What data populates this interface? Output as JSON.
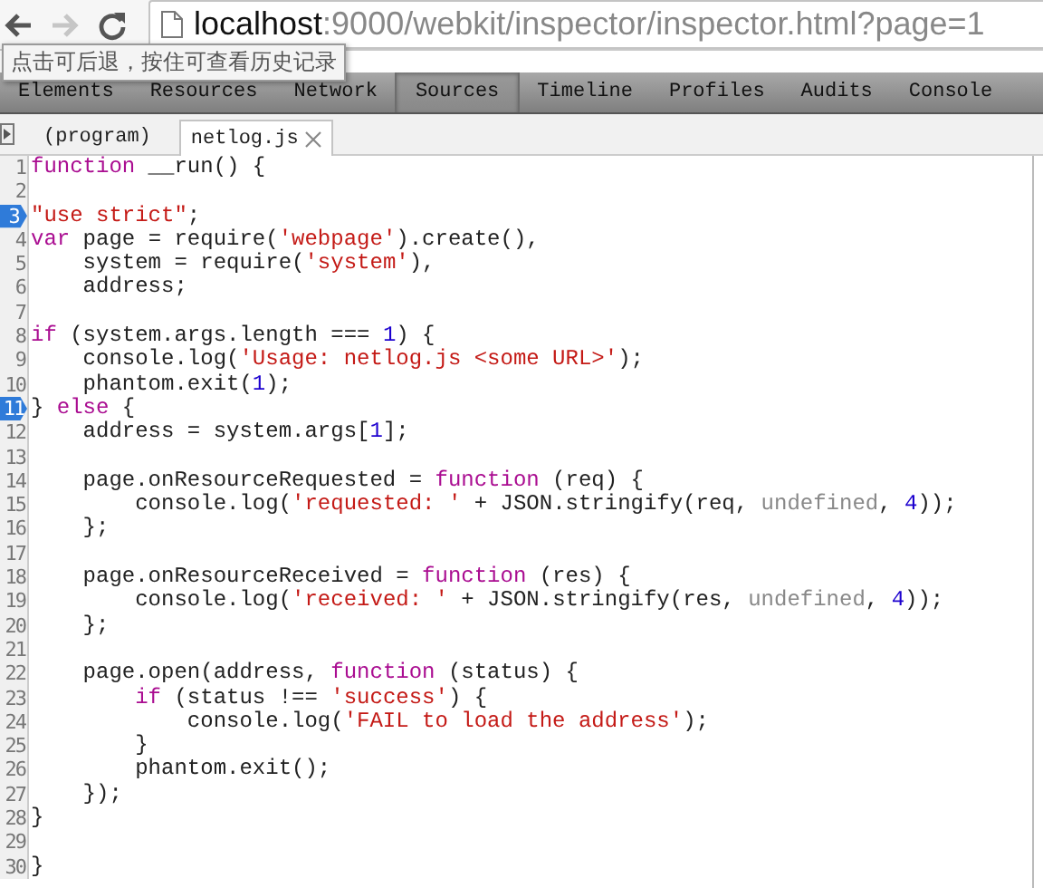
{
  "toolbar": {
    "back": {
      "disabled": false
    },
    "forward": {
      "disabled": true
    },
    "url": {
      "host": "localhost",
      "rest": ":9000/webkit/inspector/inspector.html?page=1"
    }
  },
  "tooltip": {
    "text": "点击可后退，按住可查看历史记录"
  },
  "tabs": [
    {
      "label": "Elements",
      "selected": false
    },
    {
      "label": "Resources",
      "selected": false
    },
    {
      "label": "Network",
      "selected": false
    },
    {
      "label": "Sources",
      "selected": true
    },
    {
      "label": "Timeline",
      "selected": false
    },
    {
      "label": "Profiles",
      "selected": false
    },
    {
      "label": "Audits",
      "selected": false
    },
    {
      "label": "Console",
      "selected": false
    }
  ],
  "file_tabs": [
    {
      "label": "(program)",
      "selected": false,
      "closable": false
    },
    {
      "label": "netlog.js",
      "selected": true,
      "closable": true
    }
  ],
  "code": {
    "lines": [
      {
        "number": "1",
        "breakpoint": false,
        "tokens": [
          {
            "kind": "keyword",
            "text": "function"
          },
          {
            "kind": "plain",
            "text": " __run() {"
          }
        ]
      },
      {
        "number": "2",
        "breakpoint": false
      },
      {
        "number": "3",
        "breakpoint": true,
        "tokens": [
          {
            "kind": "string",
            "text": "\"use strict\""
          },
          {
            "kind": "plain",
            "text": ";"
          }
        ]
      },
      {
        "number": "4",
        "breakpoint": false,
        "tokens": [
          {
            "kind": "keyword",
            "text": "var"
          },
          {
            "kind": "plain",
            "text": " page = require("
          },
          {
            "kind": "string",
            "text": "'webpage'"
          },
          {
            "kind": "plain",
            "text": ").create(),"
          }
        ]
      },
      {
        "number": "5",
        "breakpoint": false,
        "tokens": [
          {
            "kind": "plain",
            "text": "    system = require("
          },
          {
            "kind": "string",
            "text": "'system'"
          },
          {
            "kind": "plain",
            "text": "),"
          }
        ]
      },
      {
        "number": "6",
        "breakpoint": false,
        "tokens": [
          {
            "kind": "plain",
            "text": "    address;"
          }
        ]
      },
      {
        "number": "7",
        "breakpoint": false
      },
      {
        "number": "8",
        "breakpoint": false,
        "tokens": [
          {
            "kind": "keyword",
            "text": "if"
          },
          {
            "kind": "plain",
            "text": " (system.args.length === "
          },
          {
            "kind": "number",
            "text": "1"
          },
          {
            "kind": "plain",
            "text": ") {"
          }
        ]
      },
      {
        "number": "9",
        "breakpoint": false,
        "tokens": [
          {
            "kind": "plain",
            "text": "    console.log("
          },
          {
            "kind": "string",
            "text": "'Usage: netlog.js <some URL>'"
          },
          {
            "kind": "plain",
            "text": ");"
          }
        ]
      },
      {
        "number": "10",
        "breakpoint": false,
        "tokens": [
          {
            "kind": "plain",
            "text": "    phantom.exit("
          },
          {
            "kind": "number",
            "text": "1"
          },
          {
            "kind": "plain",
            "text": ");"
          }
        ]
      },
      {
        "number": "11",
        "breakpoint": true,
        "tokens": [
          {
            "kind": "plain",
            "text": "} "
          },
          {
            "kind": "keyword",
            "text": "else"
          },
          {
            "kind": "plain",
            "text": " {"
          }
        ]
      },
      {
        "number": "12",
        "breakpoint": false,
        "tokens": [
          {
            "kind": "plain",
            "text": "    address = system.args["
          },
          {
            "kind": "number",
            "text": "1"
          },
          {
            "kind": "plain",
            "text": "];"
          }
        ]
      },
      {
        "number": "13",
        "breakpoint": false
      },
      {
        "number": "14",
        "breakpoint": false,
        "tokens": [
          {
            "kind": "plain",
            "text": "    page.onResourceRequested = "
          },
          {
            "kind": "keyword",
            "text": "function"
          },
          {
            "kind": "plain",
            "text": " (req) {"
          }
        ]
      },
      {
        "number": "15",
        "breakpoint": false,
        "tokens": [
          {
            "kind": "plain",
            "text": "        console.log("
          },
          {
            "kind": "string",
            "text": "'requested: '"
          },
          {
            "kind": "plain",
            "text": " + JSON.stringify(req, "
          },
          {
            "kind": "muted",
            "text": "undefined"
          },
          {
            "kind": "plain",
            "text": ", "
          },
          {
            "kind": "number",
            "text": "4"
          },
          {
            "kind": "plain",
            "text": "));"
          }
        ]
      },
      {
        "number": "16",
        "breakpoint": false,
        "tokens": [
          {
            "kind": "plain",
            "text": "    };"
          }
        ]
      },
      {
        "number": "17",
        "breakpoint": false
      },
      {
        "number": "18",
        "breakpoint": false,
        "tokens": [
          {
            "kind": "plain",
            "text": "    page.onResourceReceived = "
          },
          {
            "kind": "keyword",
            "text": "function"
          },
          {
            "kind": "plain",
            "text": " (res) {"
          }
        ]
      },
      {
        "number": "19",
        "breakpoint": false,
        "tokens": [
          {
            "kind": "plain",
            "text": "        console.log("
          },
          {
            "kind": "string",
            "text": "'received: '"
          },
          {
            "kind": "plain",
            "text": " + JSON.stringify(res, "
          },
          {
            "kind": "muted",
            "text": "undefined"
          },
          {
            "kind": "plain",
            "text": ", "
          },
          {
            "kind": "number",
            "text": "4"
          },
          {
            "kind": "plain",
            "text": "));"
          }
        ]
      },
      {
        "number": "20",
        "breakpoint": false,
        "tokens": [
          {
            "kind": "plain",
            "text": "    };"
          }
        ]
      },
      {
        "number": "21",
        "breakpoint": false
      },
      {
        "number": "22",
        "breakpoint": false,
        "tokens": [
          {
            "kind": "plain",
            "text": "    page.open(address, "
          },
          {
            "kind": "keyword",
            "text": "function"
          },
          {
            "kind": "plain",
            "text": " (status) {"
          }
        ]
      },
      {
        "number": "23",
        "breakpoint": false,
        "tokens": [
          {
            "kind": "keyword",
            "text": "        if"
          },
          {
            "kind": "plain",
            "text": " (status !== "
          },
          {
            "kind": "string",
            "text": "'success'"
          },
          {
            "kind": "plain",
            "text": ") {"
          }
        ]
      },
      {
        "number": "24",
        "breakpoint": false,
        "tokens": [
          {
            "kind": "plain",
            "text": "            console.log("
          },
          {
            "kind": "string",
            "text": "'FAIL to load the address'"
          },
          {
            "kind": "plain",
            "text": ");"
          }
        ]
      },
      {
        "number": "25",
        "breakpoint": false,
        "tokens": [
          {
            "kind": "plain",
            "text": "        }"
          }
        ]
      },
      {
        "number": "26",
        "breakpoint": false,
        "tokens": [
          {
            "kind": "plain",
            "text": "        phantom.exit();"
          }
        ]
      },
      {
        "number": "27",
        "breakpoint": false,
        "tokens": [
          {
            "kind": "plain",
            "text": "    });"
          }
        ]
      },
      {
        "number": "28",
        "breakpoint": false,
        "tokens": [
          {
            "kind": "plain",
            "text": "}"
          }
        ]
      },
      {
        "number": "29",
        "breakpoint": false
      },
      {
        "number": "30",
        "breakpoint": false,
        "tokens": [
          {
            "kind": "plain",
            "text": "}"
          }
        ]
      }
    ]
  }
}
